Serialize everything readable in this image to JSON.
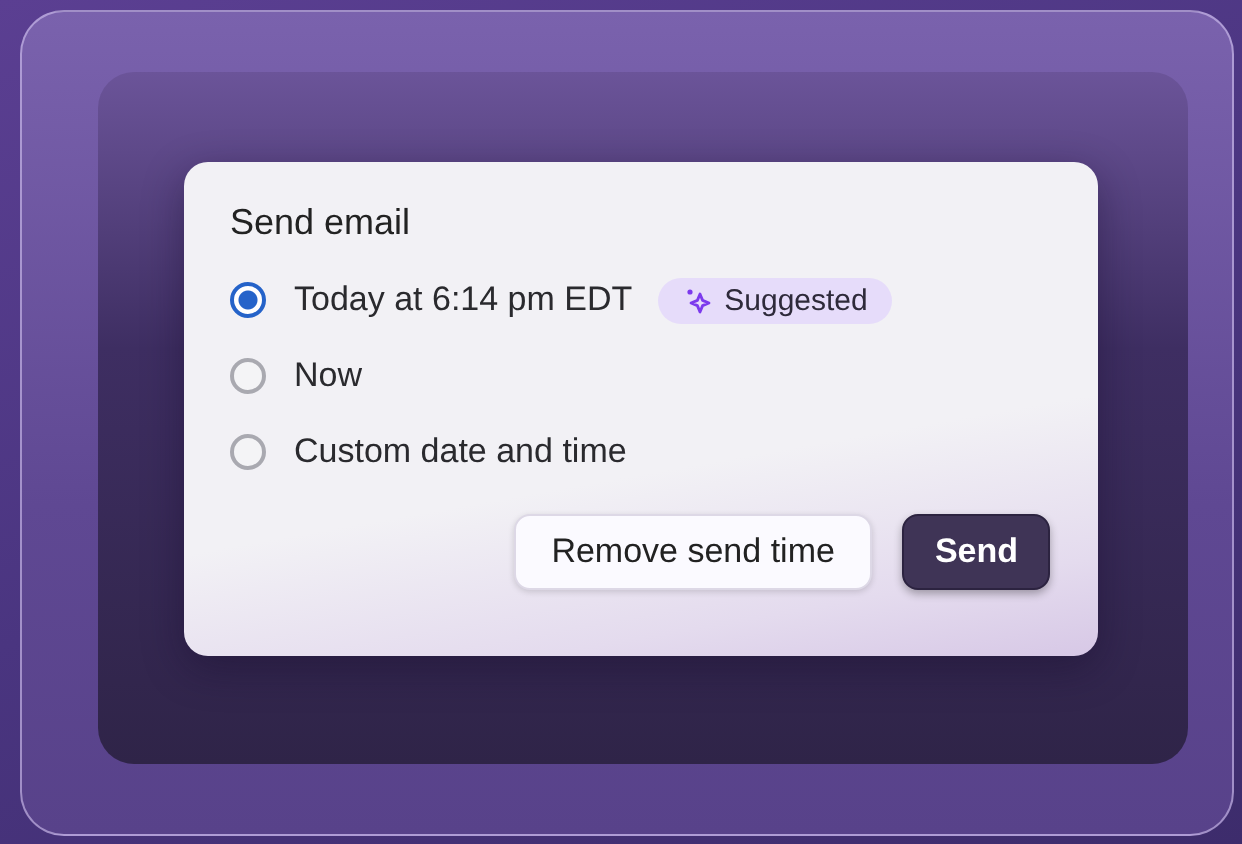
{
  "dialog": {
    "title": "Send email",
    "options": [
      {
        "label": "Today at 6:14 pm EDT",
        "selected": true,
        "badge": "Suggested"
      },
      {
        "label": "Now",
        "selected": false
      },
      {
        "label": "Custom date and time",
        "selected": false
      }
    ],
    "buttons": [
      {
        "label": "Remove send time",
        "kind": "secondary"
      },
      {
        "label": "Send",
        "kind": "primary"
      }
    ]
  }
}
